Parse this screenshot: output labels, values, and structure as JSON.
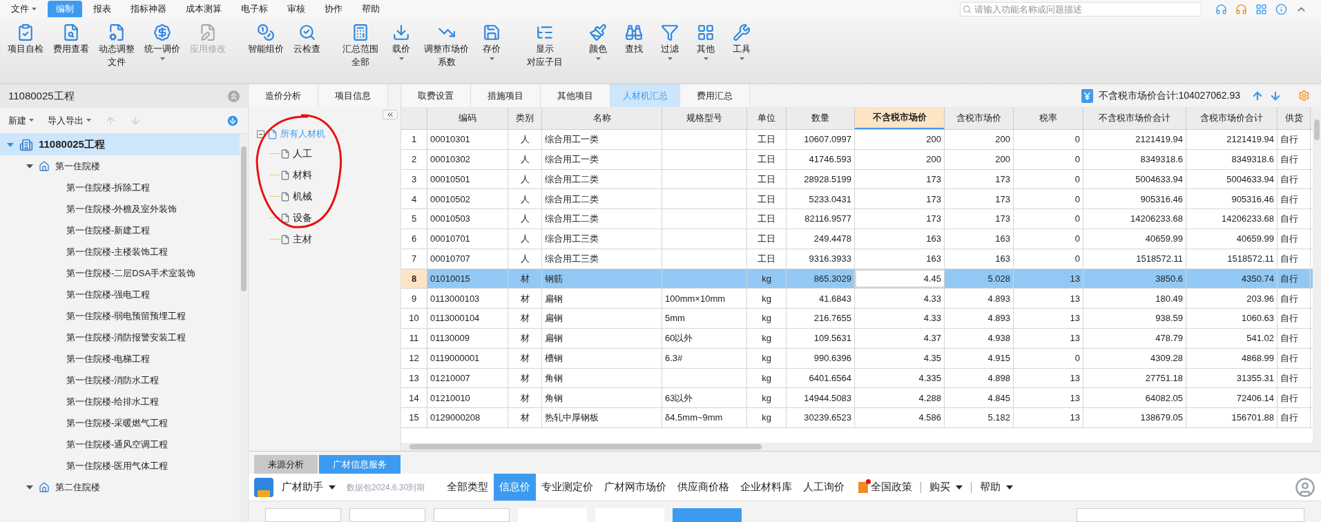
{
  "menu": [
    {
      "label": "文件",
      "dropdown": true,
      "selected": false
    },
    {
      "label": "编制",
      "dropdown": false,
      "selected": true
    },
    {
      "label": "报表",
      "dropdown": false,
      "selected": false
    },
    {
      "label": "指标神器",
      "dropdown": false,
      "selected": false
    },
    {
      "label": "成本测算",
      "dropdown": false,
      "selected": false
    },
    {
      "label": "电子标",
      "dropdown": false,
      "selected": false
    },
    {
      "label": "审核",
      "dropdown": false,
      "selected": false
    },
    {
      "label": "协作",
      "dropdown": false,
      "selected": false
    },
    {
      "label": "帮助",
      "dropdown": false,
      "selected": false
    }
  ],
  "search": {
    "placeholder": "请输入功能名称或问题描述"
  },
  "ribbon": [
    {
      "lines": [
        "项目自检"
      ],
      "dropdown": false,
      "disabled": false
    },
    {
      "lines": [
        "费用查看"
      ],
      "dropdown": false,
      "disabled": false
    },
    {
      "lines": [
        "动态调整",
        "文件"
      ],
      "dropdown": false,
      "disabled": false
    },
    {
      "lines": [
        "统一调价"
      ],
      "dropdown": true,
      "disabled": false
    },
    {
      "lines": [
        "应用修改"
      ],
      "dropdown": false,
      "disabled": true
    },
    {
      "lines": [
        "智能组价"
      ],
      "dropdown": false,
      "disabled": false
    },
    {
      "lines": [
        "云检查"
      ],
      "dropdown": false,
      "disabled": false
    },
    {
      "lines": [
        "汇总范围",
        "全部"
      ],
      "dropdown": false,
      "disabled": false
    },
    {
      "lines": [
        "载价"
      ],
      "dropdown": true,
      "disabled": false
    },
    {
      "lines": [
        "调整市场价",
        "系数"
      ],
      "dropdown": false,
      "disabled": false
    },
    {
      "lines": [
        "存价"
      ],
      "dropdown": true,
      "disabled": false
    },
    {
      "lines": [
        "显示",
        "对应子目"
      ],
      "dropdown": false,
      "disabled": false
    },
    {
      "lines": [
        "颜色"
      ],
      "dropdown": true,
      "disabled": false
    },
    {
      "lines": [
        "查找"
      ],
      "dropdown": false,
      "disabled": false
    },
    {
      "lines": [
        "过滤"
      ],
      "dropdown": true,
      "disabled": false
    },
    {
      "lines": [
        "其他"
      ],
      "dropdown": true,
      "disabled": false
    },
    {
      "lines": [
        "工具"
      ],
      "dropdown": true,
      "disabled": false
    }
  ],
  "project_panel": {
    "title": "11080025工程",
    "toolbar": [
      "新建",
      "导入导出"
    ],
    "tree": [
      {
        "label": "11080025工程",
        "selected": true,
        "expanded": true,
        "children": [
          {
            "label": "第一住院楼",
            "selected": false,
            "expanded": true,
            "children": [
              {
                "label": "第一住院楼-拆除工程",
                "selected": false
              },
              {
                "label": "第一住院楼-外檐及室外装饰",
                "selected": false
              },
              {
                "label": "第一住院楼-新建工程",
                "selected": false
              },
              {
                "label": "第一住院楼-主楼装饰工程",
                "selected": false
              },
              {
                "label": "第一住院楼-二层DSA手术室装饰",
                "selected": false
              },
              {
                "label": "第一住院楼-强电工程",
                "selected": false
              },
              {
                "label": "第一住院楼-弱电预留预埋工程",
                "selected": false
              },
              {
                "label": "第一住院楼-消防报警安装工程",
                "selected": false
              },
              {
                "label": "第一住院楼-电梯工程",
                "selected": false
              },
              {
                "label": "第一住院楼-消防水工程",
                "selected": false
              },
              {
                "label": "第一住院楼-给排水工程",
                "selected": false
              },
              {
                "label": "第一住院楼-采暖燃气工程",
                "selected": false
              },
              {
                "label": "第一住院楼-通风空调工程",
                "selected": false
              },
              {
                "label": "第一住院楼-医用气体工程",
                "selected": false
              }
            ]
          },
          {
            "label": "第二住院楼",
            "selected": false,
            "expanded": true
          }
        ]
      }
    ]
  },
  "tabs": [
    {
      "label": "造价分析",
      "selected": false
    },
    {
      "label": "项目信息",
      "selected": false
    },
    {
      "label": "取费设置",
      "selected": false
    },
    {
      "label": "措施项目",
      "selected": false
    },
    {
      "label": "其他项目",
      "selected": false
    },
    {
      "label": "人材机汇总",
      "selected": true
    },
    {
      "label": "费用汇总",
      "selected": false
    }
  ],
  "total": "不含税市场价合计:104027062.93",
  "category_tree": {
    "label": "所有人材机",
    "selected": true,
    "expanded": true,
    "children": [
      {
        "label": "人工",
        "selected": false
      },
      {
        "label": "材料",
        "selected": false
      },
      {
        "label": "机械",
        "selected": false
      },
      {
        "label": "设备",
        "selected": false
      },
      {
        "label": "主材",
        "selected": false
      }
    ]
  },
  "table": {
    "columns": [
      {
        "label": "编码",
        "selected": false
      },
      {
        "label": "类别",
        "selected": false
      },
      {
        "label": "名称",
        "selected": false
      },
      {
        "label": "规格型号",
        "selected": false
      },
      {
        "label": "单位",
        "selected": false
      },
      {
        "label": "数量",
        "selected": false
      },
      {
        "label": "不含税市场价",
        "selected": true
      },
      {
        "label": "含税市场价",
        "selected": false
      },
      {
        "label": "税率",
        "selected": false
      },
      {
        "label": "不含税市场价合计",
        "selected": false
      },
      {
        "label": "含税市场价合计",
        "selected": false
      },
      {
        "label": "供货",
        "selected": false
      }
    ],
    "rows": [
      {
        "num": "1",
        "selected": false,
        "cells": [
          "00010301",
          "人",
          "综合用工一类",
          "",
          "工日",
          "10607.0997",
          "200",
          "200",
          "0",
          "2121419.94",
          "2121419.94",
          "自行"
        ]
      },
      {
        "num": "2",
        "selected": false,
        "cells": [
          "00010302",
          "人",
          "综合用工一类",
          "",
          "工日",
          "41746.593",
          "200",
          "200",
          "0",
          "8349318.6",
          "8349318.6",
          "自行"
        ]
      },
      {
        "num": "3",
        "selected": false,
        "cells": [
          "00010501",
          "人",
          "综合用工二类",
          "",
          "工日",
          "28928.5199",
          "173",
          "173",
          "0",
          "5004633.94",
          "5004633.94",
          "自行"
        ]
      },
      {
        "num": "4",
        "selected": false,
        "cells": [
          "00010502",
          "人",
          "综合用工二类",
          "",
          "工日",
          "5233.0431",
          "173",
          "173",
          "0",
          "905316.46",
          "905316.46",
          "自行"
        ]
      },
      {
        "num": "5",
        "selected": false,
        "cells": [
          "00010503",
          "人",
          "综合用工二类",
          "",
          "工日",
          "82116.9577",
          "173",
          "173",
          "0",
          "14206233.68",
          "14206233.68",
          "自行"
        ]
      },
      {
        "num": "6",
        "selected": false,
        "cells": [
          "00010701",
          "人",
          "综合用工三类",
          "",
          "工日",
          "249.4478",
          "163",
          "163",
          "0",
          "40659.99",
          "40659.99",
          "自行"
        ]
      },
      {
        "num": "7",
        "selected": false,
        "cells": [
          "00010707",
          "人",
          "综合用工三类",
          "",
          "工日",
          "9316.3933",
          "163",
          "163",
          "0",
          "1518572.11",
          "1518572.11",
          "自行"
        ]
      },
      {
        "num": "8",
        "selected": true,
        "cells": [
          "01010015",
          "材",
          "钢筋",
          "",
          "kg",
          "865.3029",
          "4.45",
          "5.028",
          "13",
          "3850.6",
          "4350.74",
          "自行"
        ]
      },
      {
        "num": "9",
        "selected": false,
        "cells": [
          "0113000103",
          "材",
          "扁钢",
          "100mm×10mm",
          "kg",
          "41.6843",
          "4.33",
          "4.893",
          "13",
          "180.49",
          "203.96",
          "自行"
        ]
      },
      {
        "num": "10",
        "selected": false,
        "cells": [
          "0113000104",
          "材",
          "扁钢",
          "5mm",
          "kg",
          "216.7655",
          "4.33",
          "4.893",
          "13",
          "938.59",
          "1060.63",
          "自行"
        ]
      },
      {
        "num": "11",
        "selected": false,
        "cells": [
          "01130009",
          "材",
          "扁钢",
          "60以外",
          "kg",
          "109.5631",
          "4.37",
          "4.938",
          "13",
          "478.79",
          "541.02",
          "自行"
        ]
      },
      {
        "num": "12",
        "selected": false,
        "cells": [
          "0119000001",
          "材",
          "槽钢",
          "6.3#",
          "kg",
          "990.6396",
          "4.35",
          "4.915",
          "0",
          "4309.28",
          "4868.99",
          "自行"
        ]
      },
      {
        "num": "13",
        "selected": false,
        "cells": [
          "01210007",
          "材",
          "角钢",
          "",
          "kg",
          "6401.6564",
          "4.335",
          "4.898",
          "13",
          "27751.18",
          "31355.31",
          "自行"
        ]
      },
      {
        "num": "14",
        "selected": false,
        "cells": [
          "01210010",
          "材",
          "角钢",
          "63以外",
          "kg",
          "14944.5083",
          "4.288",
          "4.845",
          "13",
          "64082.05",
          "72406.14",
          "自行"
        ]
      },
      {
        "num": "15",
        "selected": false,
        "cells": [
          "0129000208",
          "材",
          "热轧中厚钢板",
          "δ4.5mm~9mm",
          "kg",
          "30239.6523",
          "4.586",
          "5.182",
          "13",
          "138679.05",
          "156701.88",
          "自行"
        ]
      }
    ]
  },
  "bottom_tabs": [
    {
      "label": "来源分析",
      "selected": false
    },
    {
      "label": "广材信息服务",
      "selected": true
    }
  ],
  "service": {
    "name": "广材助手",
    "note": "数据包2024.6.30到期",
    "nav": [
      {
        "label": "全部类型",
        "selected": false
      },
      {
        "label": "信息价",
        "selected": true
      },
      {
        "label": "专业测定价",
        "selected": false
      },
      {
        "label": "广材网市场价",
        "selected": false
      },
      {
        "label": "供应商价格",
        "selected": false
      },
      {
        "label": "企业材料库",
        "selected": false
      },
      {
        "label": "人工询价",
        "selected": false
      }
    ],
    "policy": "全国政策",
    "buy": "购买",
    "help": "帮助"
  }
}
